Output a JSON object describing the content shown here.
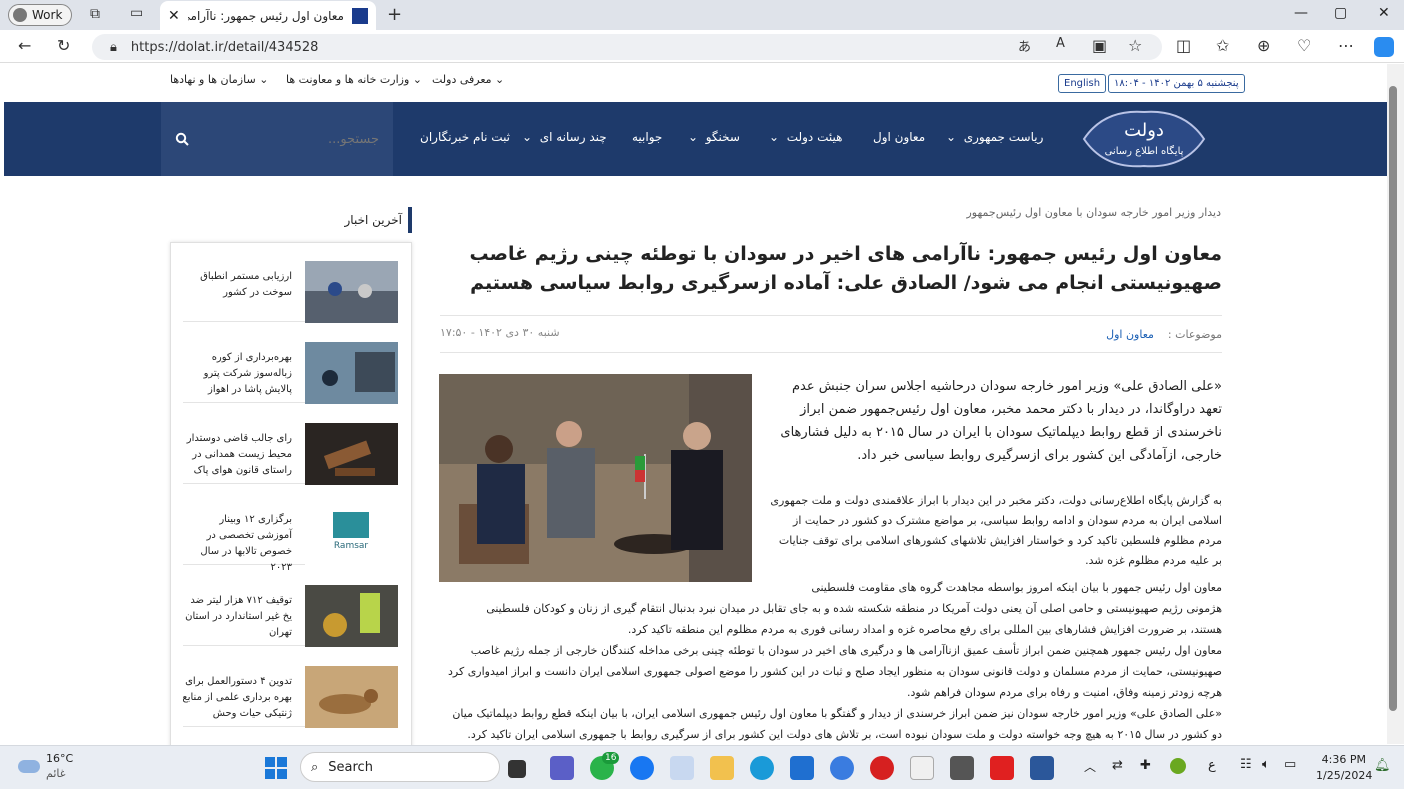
{
  "browser": {
    "profile": "Work",
    "tab_title": "معاون اول رئیس جمهور: ناآرامی ها",
    "url": "https://dolat.ir/detail/434528"
  },
  "topbar": {
    "menus": [
      "معرفی دولت",
      "وزارت خانه ها و معاونت ها",
      "سازمان ها و نهادها"
    ],
    "english": "English",
    "date": "پنجشنبه ۵ بهمن ۱۴۰۲ - ۱۸:۰۴"
  },
  "logo": {
    "text1": "دولت",
    "text2": "پایگاه اطلاع رسانی"
  },
  "mainnav": {
    "items": [
      "ریاست جمهوری",
      "معاون اول",
      "هیئت دولت",
      "سخنگو",
      "جوابیه",
      "چند رسانه ای",
      "ثبت نام خبرنگاران"
    ],
    "search_placeholder": "جستجو..."
  },
  "article": {
    "breadcrumb": "دیدار وزیر امور خارجه سودان با معاون اول رئیس‌جمهور",
    "title": "معاون اول رئیس جمهور: ناآرامی های اخیر در سودان با توطئه چینی رژیم غاصب صهیونیستی انجام می شود/ الصادق علی: آماده ازسرگیری روابط سیاسی هستیم",
    "topics_label": "موضوعات :",
    "topic": "معاون اول",
    "date": "شنبه ۳۰ دی ۱۴۰۲ - ۱۷:۵۰",
    "lead": "«علی الصادق علی» وزیر امور خارجه سودان درحاشیه اجلاس سران جنبش عدم تعهد دراوگاندا، در دیدار با دکتر محمد مخبر، معاون اول رئیس‌جمهور ضمن ابراز ناخرسندی از قطع روابط دیپلماتیک سودان با ایران در سال ۲۰۱۵ به دلیل فشارهای خارجی، ازآمادگی این کشور برای ازسرگیری روابط سیاسی خبر داد.",
    "p1": "به گزارش پایگاه اطلاع‌رسانی دولت، دکتر مخبر در این دیدار با ابراز علاقمندی دولت و ملت جمهوری اسلامی ایران به مردم سودان و ادامه روابط سیاسی، بر مواضع مشترک دو کشور در حمایت از مردم مظلوم فلسطین تاکید کرد و خواستار افزایش تلاشهای کشورهای اسلامی برای توقف جنایات بر علیه مردم مظلوم غزه شد.",
    "lines": [
      "معاون اول رئیس جمهور با بیان اینکه امروز بواسطه مجاهدت گروه های مقاومت فلسطینی",
      "هژمونی رژیم صهیونیستی و حامی اصلی آن یعنی دولت آمریکا در منطقه شکسته شده و به جای تقابل در میدان نبرد بدنبال انتقام گیری از زنان و کودکان فلسطینی",
      "هستند، بر ضرورت افزایش فشارهای بین المللی برای رفع محاصره غزه و امداد رسانی فوری به مردم مظلوم این منطقه تاکید کرد.",
      "معاون اول رئیس جمهور همچنین ضمن ابراز تأسف عمیق ازناآرامی ها و درگیری های اخیر در سودان با توطئه چینی برخی مداخله کنندگان خارجی از جمله رژیم غاصب",
      "صهیونیستی، حمایت از مردم مسلمان و دولت قانونی سودان به منظور ایجاد صلح و ثبات در این کشور را موضع اصولی جمهوری اسلامی ایران دانست و ابراز امیدواری کرد",
      "هرچه زودتر زمینه وفاق، امنیت و رفاه برای مردم سودان فراهم شود.",
      "«علی الصادق علی» وزیر امور خارجه سودان نیز ضمن ابراز خرسندی از دیدار و گفتگو با معاون اول رئیس جمهوری اسلامی ایران، با بیان اینکه قطع روابط دیپلماتیک میان",
      "دو کشور در سال ۲۰۱۵ به هیچ وجه خواسته دولت و ملت سودان نبوده است، بر تلاش های دولت این کشور برای از سرگیری روابط با جمهوری اسلامی ایران تاکید کرد."
    ]
  },
  "sidebar": {
    "heading": "آخرین اخبار",
    "items": [
      "ارزیابی مستمر انطباق سوخت در کشور",
      "بهره‌برداری از کوره زباله‌سوز شرکت پترو پالایش پاشا در اهواز",
      "رای جالب قاضی دوستدار محیط زیست همدانی در راستای قانون هوای پاک",
      "برگزاری ۱۲ وبینار آموزشی تخصصی در خصوص تالابها در سال ۲۰۲۳",
      "توقیف ۷۱۲ هزار لیتر ضد یخ غیر استاندارد در استان تهران",
      "تدوین ۴ دستورالعمل برای بهره برداری علمی از منابع ژنتیکی حیات وحش"
    ],
    "ramsar": "Ramsar"
  },
  "taskbar": {
    "temp": "16°C",
    "condition": "غائم",
    "search": "Search",
    "badge": "16",
    "lang": "ع",
    "time": "4:36 PM",
    "date": "1/25/2024"
  }
}
